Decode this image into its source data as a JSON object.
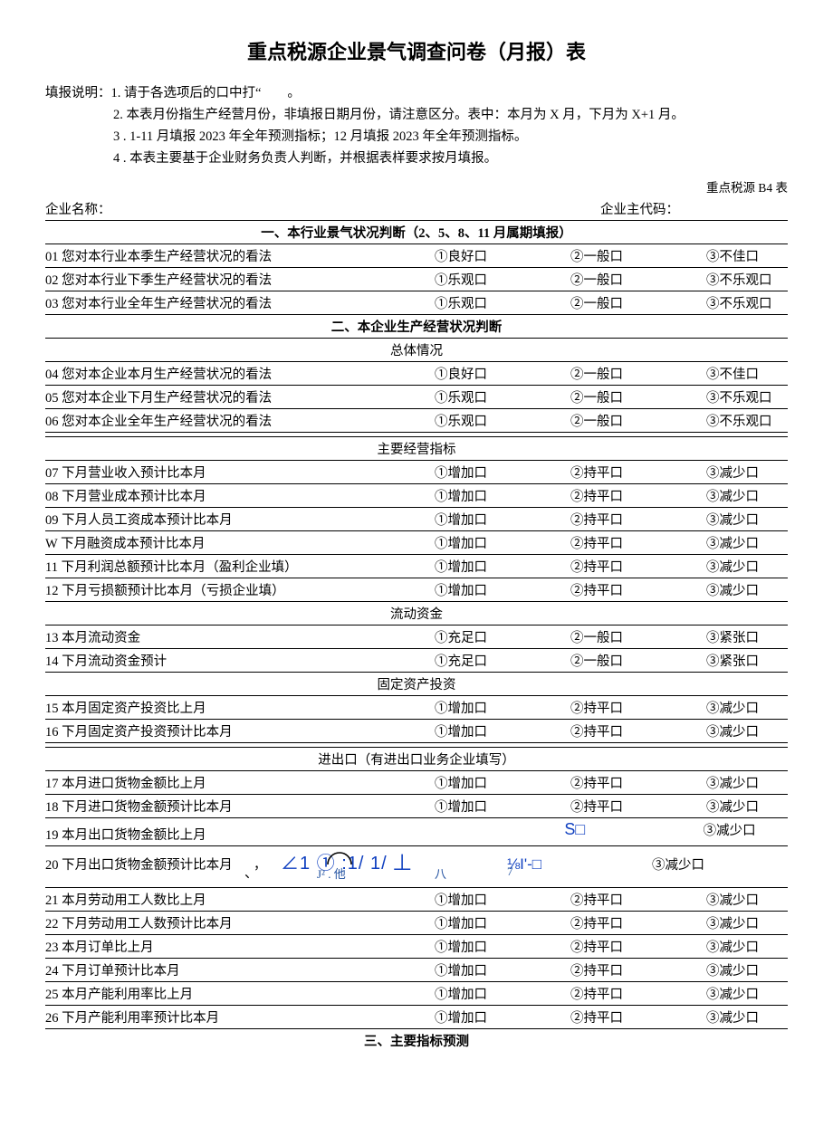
{
  "title": "重点税源企业景气调查问卷（月报）表",
  "instructions": {
    "prefix": "填报说明：",
    "l1": "1. 请于各选项后的口中打“　　。",
    "l2": "2. 本表月份指生产经营月份，非填报日期月份，请注意区分。表中：本月为 X 月，下月为 X+1 月。",
    "l3": "3 . 1-11 月填报 2023 年全年预测指标；12 月填报 2023 年全年预测指标。",
    "l4": "4 . 本表主要基于企业财务负责人判断，并根据表样要求按月填报。"
  },
  "form_code": "重点税源 B4 表",
  "company_name_label": "企业名称：",
  "company_code_label": "企业主代码：",
  "section1": {
    "header": "一、本行业景气状况判断（2、5、8、11 月属期填报）",
    "q01": {
      "label": "01 您对本行业本季生产经营状况的看法",
      "o1": "①良好口",
      "o2": "②一般口",
      "o3": "③不佳口"
    },
    "q02": {
      "label": "02 您对本行业下季生产经营状况的看法",
      "o1": "①乐观口",
      "o2": "②一般口",
      "o3": "③不乐观口"
    },
    "q03": {
      "label": "03 您对本行业全年生产经营状况的看法",
      "o1": "①乐观口",
      "o2": "②一般口",
      "o3": "③不乐观口"
    }
  },
  "section2": {
    "header": "二、本企业生产经营状况判断",
    "sub_overall": "总体情况",
    "q04": {
      "label": "04 您对本企业本月生产经营状况的看法",
      "o1": "①良好口",
      "o2": "②一般口",
      "o3": "③不佳口"
    },
    "q05": {
      "label": "05 您对本企业下月生产经营状况的看法",
      "o1": "①乐观口",
      "o2": "②一般口",
      "o3": "③不乐观口"
    },
    "q06": {
      "label": "06 您对本企业全年生产经营状况的看法",
      "o1": "①乐观口",
      "o2": "②一般口",
      "o3": "③不乐观口"
    },
    "sub_main": "主要经营指标",
    "q07": {
      "label": "07 下月营业收入预计比本月",
      "o1": "①增加口",
      "o2": "②持平口",
      "o3": "③减少口"
    },
    "q08": {
      "label": "08 下月营业成本预计比本月",
      "o1": "①增加口",
      "o2": "②持平口",
      "o3": "③减少口"
    },
    "q09": {
      "label": "09 下月人员工资成本预计比本月",
      "o1": "①增加口",
      "o2": "②持平口",
      "o3": "③减少口"
    },
    "qW": {
      "label": "W 下月融资成本预计比本月",
      "o1": "①增加口",
      "o2": "②持平口",
      "o3": "③减少口"
    },
    "q11": {
      "label": "11 下月利润总额预计比本月（盈利企业填）",
      "o1": "①增加口",
      "o2": "②持平口",
      "o3": "③减少口"
    },
    "q12": {
      "label": "12 下月亏损额预计比本月（亏损企业填）",
      "o1": "①增加口",
      "o2": "②持平口",
      "o3": "③减少口"
    },
    "sub_liquid": "流动资金",
    "q13": {
      "label": "13 本月流动资金",
      "o1": "①充足口",
      "o2": "②一般口",
      "o3": "③紧张口"
    },
    "q14": {
      "label": "14 下月流动资金预计",
      "o1": "①充足口",
      "o2": "②一般口",
      "o3": "③紧张口"
    },
    "sub_fixed": "固定资产投资",
    "q15": {
      "label": "15 本月固定资产投资比上月",
      "o1": "①增加口",
      "o2": "②持平口",
      "o3": "③减少口"
    },
    "q16": {
      "label": "16 下月固定资产投资预计比本月",
      "o1": "①增加口",
      "o2": "②持平口",
      "o3": "③减少口"
    },
    "sub_impexp": "进出口（有进出口业务企业填写）",
    "q17": {
      "label": "17 本月进口货物金额比上月",
      "o1": "①增加口",
      "o2": "②持平口",
      "o3": "③减少口"
    },
    "q18": {
      "label": "18 下月进口货物金额预计比本月",
      "o1": "①增加口",
      "o2": "②持平口",
      "o3": "③减少口"
    },
    "q19": {
      "label": "19 本月出口货物金额比上月",
      "o1": "",
      "o2": "S□",
      "o3": "③减少口"
    },
    "q20": {
      "label": "20 下月出口货物金额预计比本月",
      "punct": "，",
      "mid": "∠1 ① :1/ 1/ 丄",
      "o2": "⅛Ι'-□",
      "o3": "③减少口",
      "sub1": "J² . 他",
      "sub2": "八",
      "sub3": "7"
    },
    "q21": {
      "label": "21 本月劳动用工人数比上月",
      "o1": "①增加口",
      "o2": "②持平口",
      "o3": "③减少口"
    },
    "q22": {
      "label": "22 下月劳动用工人数预计比本月",
      "o1": "①增加口",
      "o2": "②持平口",
      "o3": "③减少口"
    },
    "q23": {
      "label": "23 本月订单比上月",
      "o1": "①增加口",
      "o2": "②持平口",
      "o3": "③减少口"
    },
    "q24": {
      "label": "24 下月订单预计比本月",
      "o1": "①增加口",
      "o2": "②持平口",
      "o3": "③减少口"
    },
    "q25": {
      "label": "25 本月产能利用率比上月",
      "o1": "①增加口",
      "o2": "②持平口",
      "o3": "③减少口"
    },
    "q26": {
      "label": "26 下月产能利用率预计比本月",
      "o1": "①增加口",
      "o2": "②持平口",
      "o3": "③减少口"
    }
  },
  "section3_header": "三、主要指标预测"
}
